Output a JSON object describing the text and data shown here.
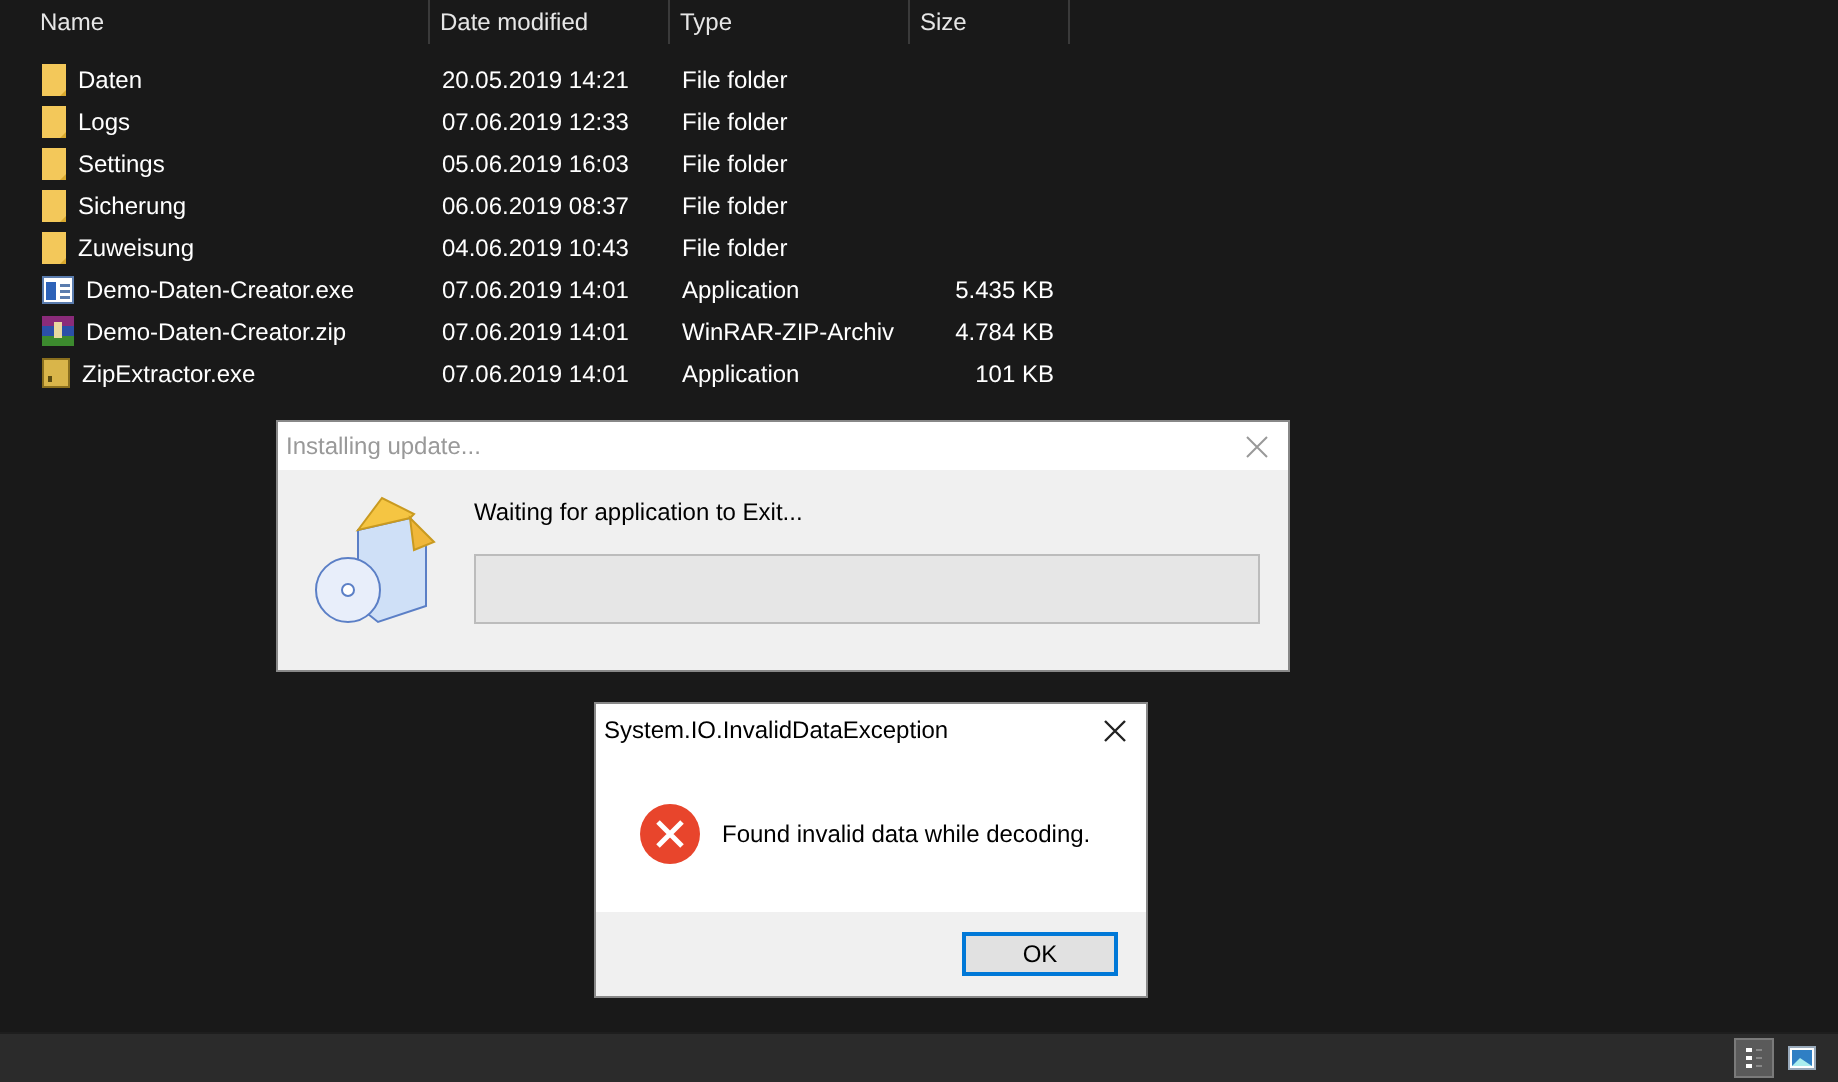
{
  "file_list": {
    "columns": [
      "Name",
      "Date modified",
      "Type",
      "Size"
    ],
    "rows": [
      {
        "kind": "folder",
        "name": "Daten",
        "date": "20.05.2019 14:21",
        "type": "File folder",
        "size": ""
      },
      {
        "kind": "folder",
        "name": "Logs",
        "date": "07.06.2019 12:33",
        "type": "File folder",
        "size": ""
      },
      {
        "kind": "folder",
        "name": "Settings",
        "date": "05.06.2019 16:03",
        "type": "File folder",
        "size": ""
      },
      {
        "kind": "folder",
        "name": "Sicherung",
        "date": "06.06.2019 08:37",
        "type": "File folder",
        "size": ""
      },
      {
        "kind": "folder",
        "name": "Zuweisung",
        "date": "04.06.2019 10:43",
        "type": "File folder",
        "size": ""
      },
      {
        "kind": "window-app",
        "name": "Demo-Daten-Creator.exe",
        "date": "07.06.2019 14:01",
        "type": "Application",
        "size": "5.435 KB"
      },
      {
        "kind": "archive",
        "name": "Demo-Daten-Creator.zip",
        "date": "07.06.2019 14:01",
        "type": "WinRAR-ZIP-Archiv",
        "size": "4.784 KB"
      },
      {
        "kind": "box-app",
        "name": "ZipExtractor.exe",
        "date": "07.06.2019 14:01",
        "type": "Application",
        "size": "101 KB"
      }
    ]
  },
  "update_dialog": {
    "title": "Installing update...",
    "message": "Waiting for application to Exit...",
    "level": 0
  },
  "error_dialog": {
    "title": "System.IO.InvalidDataException",
    "message": "Found invalid data while decoding.",
    "button": "OK"
  },
  "status_bar": {
    "view_buttons": [
      {
        "kind": "details",
        "selected": true
      },
      {
        "kind": "preview",
        "selected": false
      }
    ]
  }
}
